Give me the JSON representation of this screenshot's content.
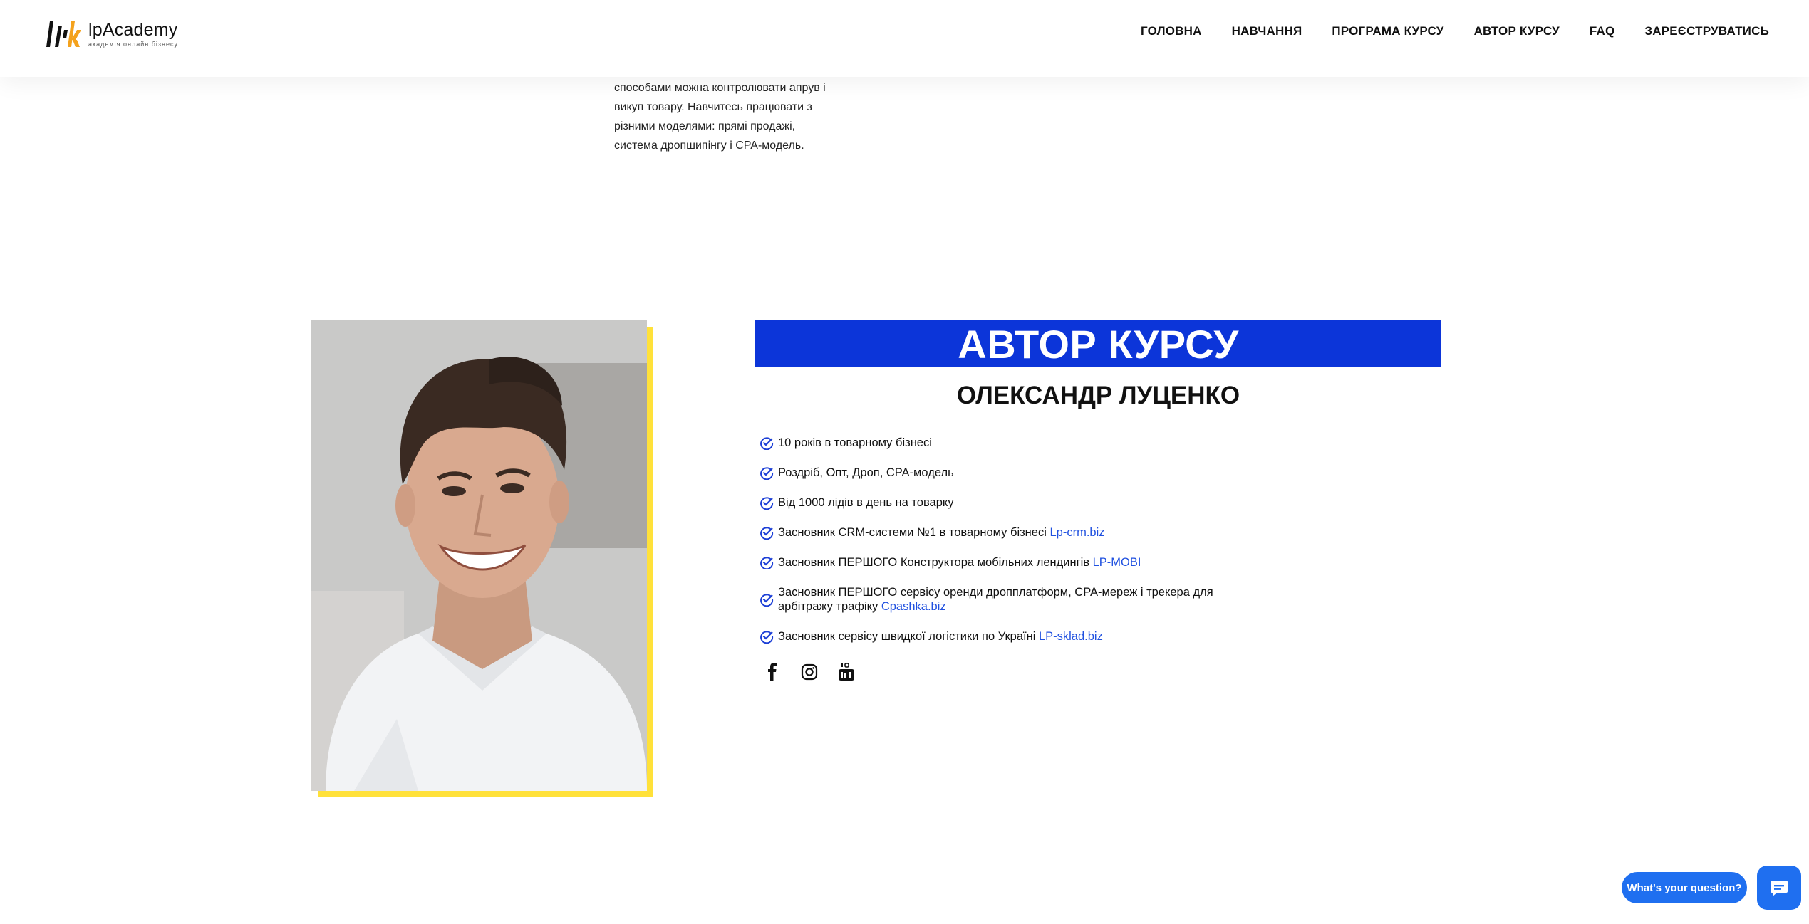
{
  "header": {
    "logo": {
      "name": "lpAcademy",
      "tagline": "академія онлайн бізнесу"
    },
    "nav": [
      "ГОЛОВНА",
      "НАВЧАННЯ",
      "ПРОГРАМА КУРСУ",
      "АВТОР КУРСУ",
      "FAQ",
      "ЗАРЕЄСТРУВАТИСЬ"
    ]
  },
  "previous_section": {
    "lines": [
      "способами можна контролювати апрув і",
      "викуп товару. Навчитесь працювати з",
      "різними моделями: прямі продажі,",
      "система дропшипінгу і CPA-модель."
    ]
  },
  "author": {
    "banner_title": "АВТОР КУРСУ",
    "name": "ОЛЕКСАНДР ЛУЦЕНКО",
    "facts": [
      {
        "text": "10 років в товарному бізнесі",
        "link": ""
      },
      {
        "text": "Роздріб, Опт, Дроп, CPA-модель",
        "link": ""
      },
      {
        "text": "Від 1000 лідів в день на товарку",
        "link": ""
      },
      {
        "text": "Засновник CRM-системи №1 в товарному бізнесі ",
        "link": "Lp-crm.biz"
      },
      {
        "text": "Засновник ПЕРШОГО Конструктора мобільних лендингів ",
        "link": "LP-MOBI"
      },
      {
        "text": "Засновник ПЕРШОГО сервісу оренди дропплатформ, CPA-мереж і трекера для арбітражу трафіку ",
        "link": "Cpashka.biz"
      },
      {
        "text": "Засновник сервісу швидкої логістики по Україні ",
        "link": "LP-sklad.biz"
      }
    ],
    "socials": [
      "facebook-icon",
      "instagram-icon",
      "youtube-icon"
    ]
  },
  "chat": {
    "label": "What's your question?"
  },
  "colors": {
    "banner": "#0c35d9",
    "accent_yellow": "#ffe13a",
    "link": "#2051e0",
    "chat": "#1f6ff0"
  }
}
